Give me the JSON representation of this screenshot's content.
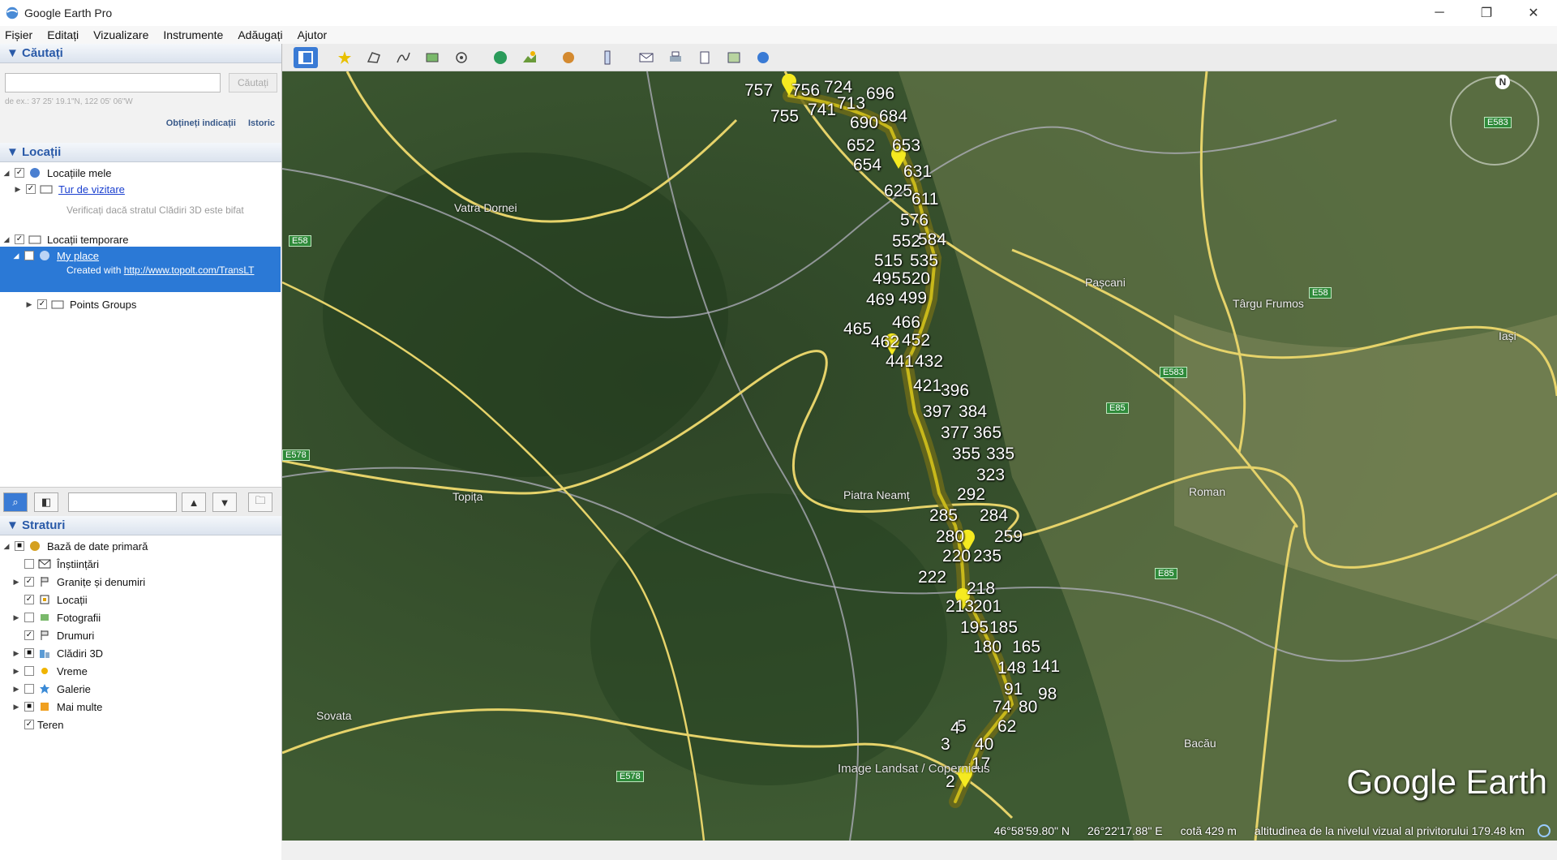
{
  "window": {
    "title": "Google Earth Pro",
    "controls": [
      "─",
      "❐",
      "✕"
    ]
  },
  "menu": [
    "Fișier",
    "Editați",
    "Vizualizare",
    "Instrumente",
    "Adăugați",
    "Ajutor"
  ],
  "search": {
    "header": "▼ Căutați",
    "placeholder": "",
    "button": "Căutați",
    "hint": "de ex.: 37 25' 19.1\"N, 122 05' 06\"W",
    "link_directions": "Obțineți indicații",
    "link_history": "Istoric"
  },
  "places": {
    "header": "▼ Locații",
    "items": [
      {
        "label": "Locațiile mele"
      },
      {
        "label": "Tur de vizitare"
      },
      {
        "label": "Verificați dacă stratul Clădiri 3D este bifat"
      },
      {
        "label": "Locații temporare"
      },
      {
        "label": "My place"
      },
      {
        "label": "Created with"
      },
      {
        "label": "http://www.topolt.com/TransLT"
      },
      {
        "label": "Points Groups"
      }
    ]
  },
  "layers": {
    "header": "▼ Straturi",
    "items": [
      {
        "label": "Bază de date primară"
      },
      {
        "label": "Înștiințări"
      },
      {
        "label": "Granițe și denumiri"
      },
      {
        "label": "Locații"
      },
      {
        "label": "Fotografii"
      },
      {
        "label": "Drumuri"
      },
      {
        "label": "Clădiri 3D"
      },
      {
        "label": "Vreme"
      },
      {
        "label": "Galerie"
      },
      {
        "label": "Mai multe"
      },
      {
        "label": "Teren"
      }
    ]
  },
  "map": {
    "cities": [
      "Vatra Dornei",
      "Pașcani",
      "Târgu Frumos",
      "Iași",
      "Piatra Neamț",
      "Roman",
      "Topița",
      "Sovata",
      "Bacău"
    ],
    "road_badges": [
      "E58",
      "E58",
      "E583",
      "E85",
      "E85",
      "E583",
      "E578",
      "E578"
    ],
    "waypoints": [
      "757",
      "756",
      "724",
      "696",
      "755",
      "741",
      "713",
      "690",
      "684",
      "652",
      "653",
      "654",
      "631",
      "625",
      "611",
      "576",
      "552",
      "584",
      "515",
      "535",
      "495",
      "520",
      "469",
      "499",
      "466",
      "465",
      "462",
      "452",
      "441",
      "432",
      "421",
      "396",
      "397",
      "384",
      "377",
      "365",
      "355",
      "335",
      "323",
      "292",
      "285",
      "284",
      "280",
      "259",
      "220",
      "235",
      "222",
      "218",
      "213",
      "201",
      "195",
      "185",
      "180",
      "165",
      "148",
      "141",
      "91",
      "98",
      "74",
      "80",
      "62",
      "5",
      "40",
      "4",
      "3",
      "17",
      "2"
    ],
    "credit": "Image Landsat / Copernicus",
    "logo": "Google Earth",
    "status": {
      "lat": "46°58'59.80\" N",
      "lon": "26°22'17.88\" E",
      "elev": "cotă   429 m",
      "eye": "altitudinea de la nivelul vizual al privitorului 179.48 km"
    }
  }
}
